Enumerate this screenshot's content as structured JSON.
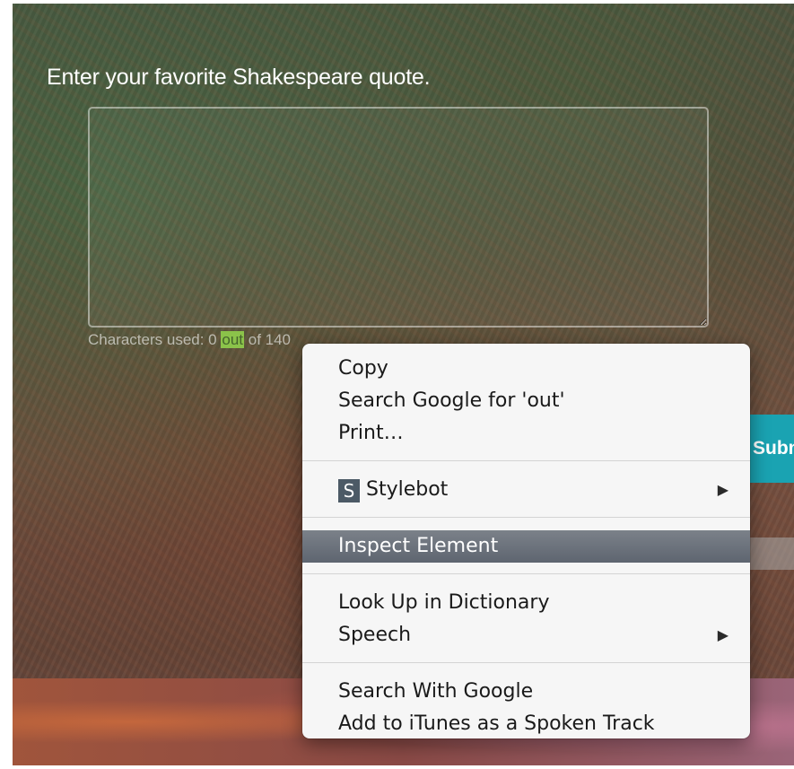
{
  "form": {
    "heading": "Enter your favorite Shakespeare quote.",
    "textarea_value": "",
    "counter": {
      "prefix": "Characters used: 0",
      "highlighted": "out",
      "suffix": "of 140"
    },
    "submit_label": "Submit"
  },
  "context_menu": {
    "group1": [
      "Copy",
      "Search Google for 'out'",
      "Print…"
    ],
    "stylebot": {
      "badge": "S",
      "label": "Stylebot",
      "has_submenu": true
    },
    "inspect": {
      "label": "Inspect Element",
      "highlighted": true
    },
    "dictionary": "Look Up in Dictionary",
    "speech": {
      "label": "Speech",
      "has_submenu": true
    },
    "search_with_google": "Search With Google",
    "itunes": "Add to iTunes as a Spoken Track"
  },
  "icons": {
    "submenu_arrow": "submenu-arrow-icon",
    "stylebot": "stylebot-icon"
  },
  "colors": {
    "submit_bg": "#1aa3b2",
    "counter_highlight": "#8bc34a",
    "menu_highlight": "#5e6570"
  }
}
